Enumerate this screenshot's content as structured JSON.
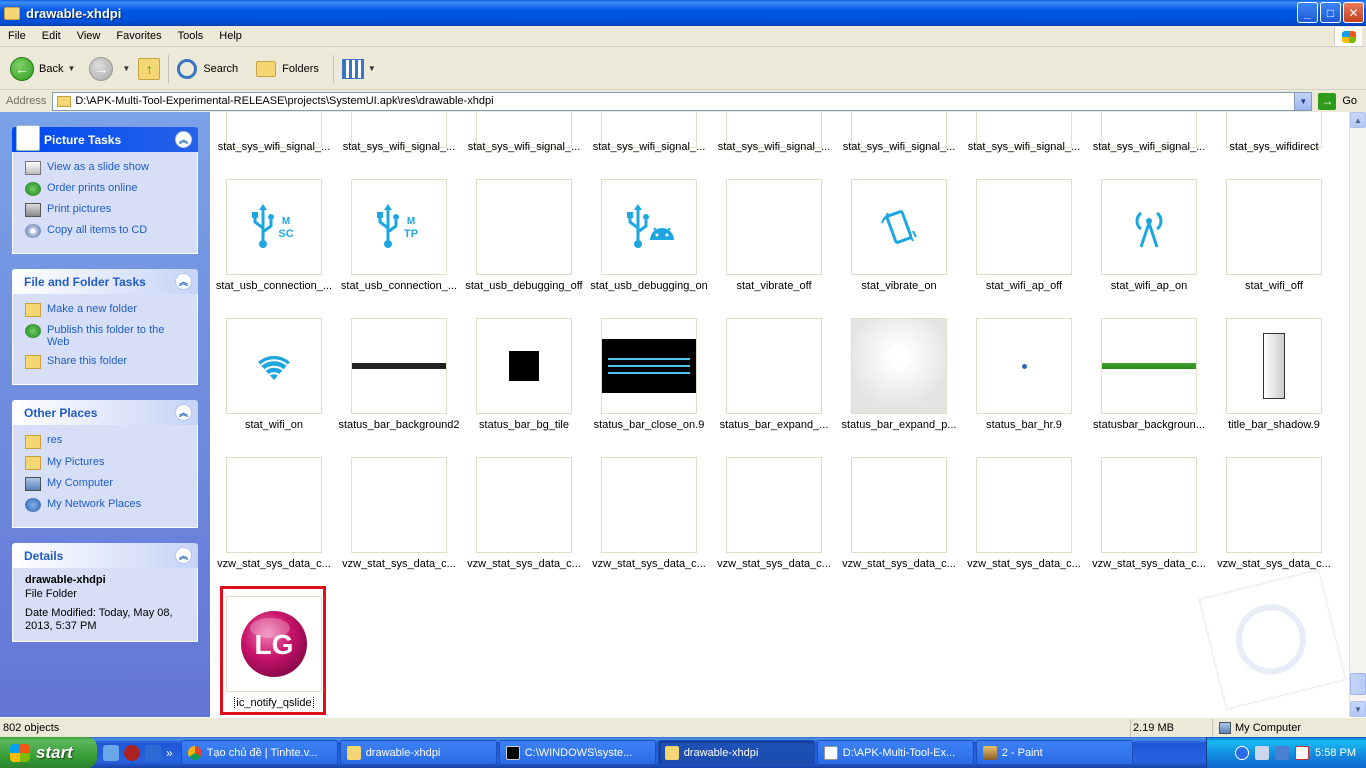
{
  "window": {
    "title": "drawable-xhdpi",
    "controls": {
      "minimize": "_",
      "maximize": "□",
      "close": "✕"
    }
  },
  "menu": [
    "File",
    "Edit",
    "View",
    "Favorites",
    "Tools",
    "Help"
  ],
  "toolbar": {
    "back": "Back",
    "search": "Search",
    "folders": "Folders"
  },
  "address": {
    "label": "Address",
    "path": "D:\\APK-Multi-Tool-Experimental-RELEASE\\projects\\SystemUI.apk\\res\\drawable-xhdpi",
    "go": "Go"
  },
  "sidebar": {
    "picture_tasks": {
      "title": "Picture Tasks",
      "items": [
        "View as a slide show",
        "Order prints online",
        "Print pictures",
        "Copy all items to CD"
      ]
    },
    "file_tasks": {
      "title": "File and Folder Tasks",
      "items": [
        "Make a new folder",
        "Publish this folder to the Web",
        "Share this folder"
      ]
    },
    "other_places": {
      "title": "Other Places",
      "items": [
        "res",
        "My Pictures",
        "My Computer",
        "My Network Places"
      ]
    },
    "details": {
      "title": "Details",
      "name": "drawable-xhdpi",
      "type": "File Folder",
      "modified": "Date Modified: Today, May 08, 2013, 5:37 PM"
    }
  },
  "files": {
    "row0": [
      "stat_sys_wifi_signal_...",
      "stat_sys_wifi_signal_...",
      "stat_sys_wifi_signal_...",
      "stat_sys_wifi_signal_...",
      "stat_sys_wifi_signal_...",
      "stat_sys_wifi_signal_...",
      "stat_sys_wifi_signal_...",
      "stat_sys_wifi_signal_...",
      "stat_sys_wifidirect"
    ],
    "row1": [
      "stat_usb_connection_...",
      "stat_usb_connection_...",
      "stat_usb_debugging_off",
      "stat_usb_debugging_on",
      "stat_vibrate_off",
      "stat_vibrate_on",
      "stat_wifi_ap_off",
      "stat_wifi_ap_on",
      "stat_wifi_off"
    ],
    "row2": [
      "stat_wifi_on",
      "status_bar_background2",
      "status_bar_bg_tile",
      "status_bar_close_on.9",
      "status_bar_expand_...",
      "status_bar_expand_p...",
      "status_bar_hr.9",
      "statusbar_backgroun...",
      "title_bar_shadow.9"
    ],
    "row3": [
      "vzw_stat_sys_data_c...",
      "vzw_stat_sys_data_c...",
      "vzw_stat_sys_data_c...",
      "vzw_stat_sys_data_c...",
      "vzw_stat_sys_data_c...",
      "vzw_stat_sys_data_c...",
      "vzw_stat_sys_data_c...",
      "vzw_stat_sys_data_c...",
      "vzw_stat_sys_data_c..."
    ],
    "row4": [
      "ic_notify_qslide"
    ],
    "icon_text": {
      "usb_msc_top": "M",
      "usb_msc_bottom": "SC",
      "usb_mtp_top": "M",
      "usb_mtp_bottom": "TP",
      "lg": "LG"
    }
  },
  "status": {
    "objects": "802 objects",
    "size": "2.19 MB",
    "zone": "My Computer"
  },
  "taskbar": {
    "start": "start",
    "overflow": "»",
    "tasks": [
      "Tạo chủ đề | Tinhte.v...",
      "drawable-xhdpi",
      "C:\\WINDOWS\\syste...",
      "drawable-xhdpi",
      "D:\\APK-Multi-Tool-Ex...",
      "2 - Paint"
    ],
    "clock": "5:58 PM"
  },
  "colors": {
    "icon_blue": "#1FA6E0",
    "selection_red": "#E0101A",
    "lg_magenta": "#C8136B"
  }
}
